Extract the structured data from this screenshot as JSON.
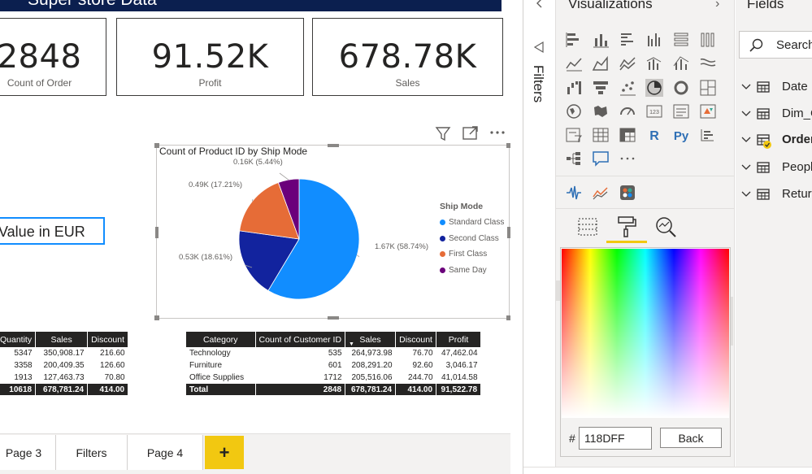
{
  "report": {
    "title": "Super store Data",
    "cards": [
      {
        "value": "2848",
        "label": "Count of Order"
      },
      {
        "value": "91.52K",
        "label": "Profit"
      },
      {
        "value": "678.78K",
        "label": "Sales"
      }
    ],
    "currency_label": "Value in  EUR"
  },
  "chart_data": {
    "type": "pie",
    "title": "Count of Product ID by Ship Mode",
    "legend_title": "Ship Mode",
    "legend_position": "right",
    "categories": [
      "Standard Class",
      "Second Class",
      "First Class",
      "Same Day"
    ],
    "values": [
      1670,
      530,
      490,
      160
    ],
    "percents": [
      58.74,
      18.61,
      17.21,
      5.44
    ],
    "data_labels": [
      "1.67K (58.74%)",
      "0.53K (18.61%)",
      "0.49K (17.21%)",
      "0.16K (5.44%)"
    ],
    "colors": [
      "#118dff",
      "#12239e",
      "#e66c37",
      "#6b007b"
    ]
  },
  "table_left": {
    "headers": [
      "Quantity",
      "Sales",
      "Discount"
    ],
    "rows": [
      [
        "5347",
        "350,908.17",
        "216.60"
      ],
      [
        "3358",
        "200,409.35",
        "126.60"
      ],
      [
        "1913",
        "127,463.73",
        "70.80"
      ]
    ],
    "total": [
      "10618",
      "678,781.24",
      "414.00"
    ]
  },
  "table_right": {
    "headers": [
      "Category",
      "Count of Customer ID",
      "Sales",
      "Discount",
      "Profit"
    ],
    "rows": [
      [
        "Technology",
        "535",
        "264,973.98",
        "76.70",
        "47,462.04"
      ],
      [
        "Furniture",
        "601",
        "208,291.20",
        "92.60",
        "3,046.17"
      ],
      [
        "Office Supplies",
        "1712",
        "205,516.06",
        "244.70",
        "41,014.58"
      ]
    ],
    "total": [
      "Total",
      "2848",
      "678,781.24",
      "414.00",
      "91,522.78"
    ]
  },
  "page_tabs": [
    "Page 3",
    "Filters",
    "Page 4"
  ],
  "add_page_label": "+",
  "filters_pane": {
    "label": "Filters"
  },
  "viz_pane": {
    "title": "Visualizations",
    "collapse_icon": "chevron-right-icon",
    "custom_icons": [
      "R",
      "Py",
      "123"
    ]
  },
  "color_picker": {
    "hash": "#",
    "hex_value": "118DFF",
    "back_label": "Back"
  },
  "fields_pane": {
    "title": "Fields",
    "search_placeholder": "Search",
    "items": [
      "Date",
      "Dim_C",
      "Order",
      "People",
      "Return"
    ]
  }
}
